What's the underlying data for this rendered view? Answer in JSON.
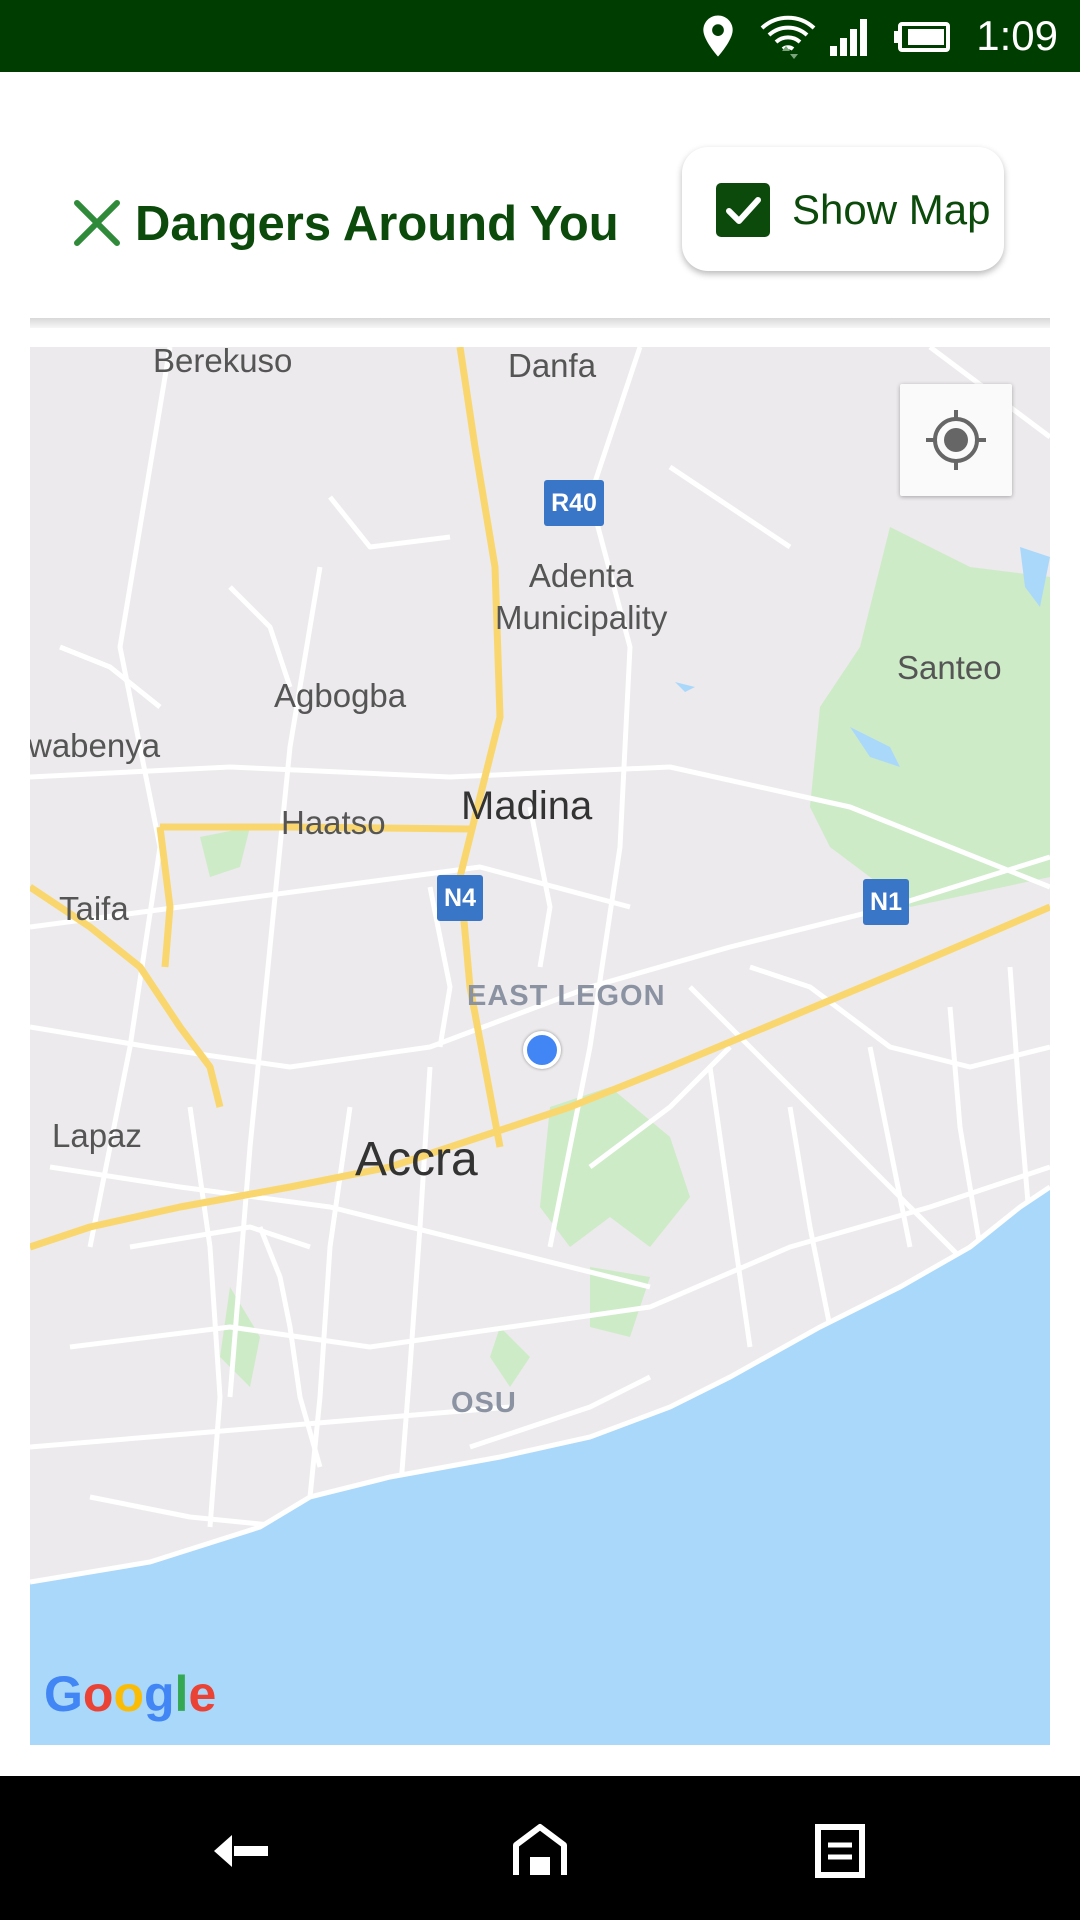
{
  "status_bar": {
    "time": "1:09",
    "icons": [
      "location-pin-icon",
      "wifi-icon",
      "cell-signal-icon",
      "battery-icon"
    ],
    "background_color": "#003d00"
  },
  "header": {
    "title": "Dangers Around You",
    "close_icon": "close-icon",
    "show_map": {
      "label": "Show Map",
      "checked": true
    },
    "accent_color": "#0b4a0b"
  },
  "map": {
    "provider_logo": "Google",
    "places": {
      "berekuso": "Berekuso",
      "danfa": "Danfa",
      "adenta": "Adenta\nMunicipality",
      "santeo": "Santeo",
      "agbogba": "Agbogba",
      "wabenya": "wabenya",
      "haatso": "Haatso",
      "madina": "Madina",
      "taifa": "Taifa",
      "east_legon": "EAST LEGON",
      "lapaz": "Lapaz",
      "accra": "Accra",
      "osu": "OSU"
    },
    "road_shields": {
      "r40": "R40",
      "n4": "N4",
      "n1": "N1"
    },
    "colors": {
      "land": "#eceaec",
      "water": "#aad8fb",
      "park": "#cdebc7",
      "highway": "#f9d76e",
      "user_location": "#4285f4"
    }
  },
  "nav_bar": {
    "buttons": [
      "back-icon",
      "home-icon",
      "recents-icon"
    ]
  }
}
